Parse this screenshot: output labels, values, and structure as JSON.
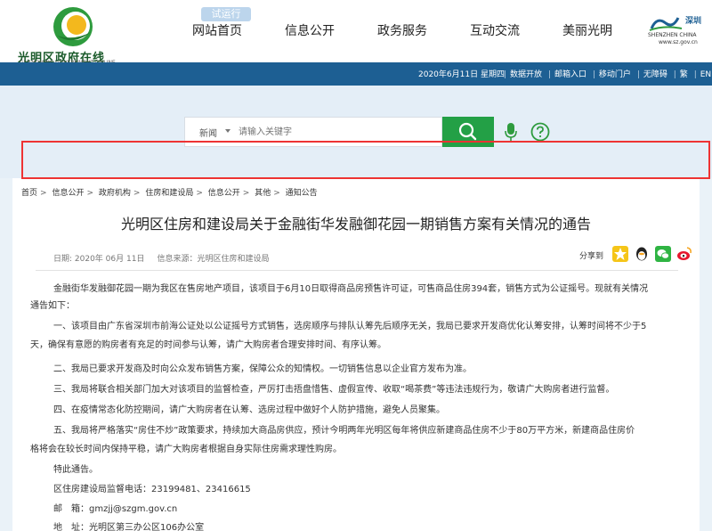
{
  "header": {
    "logo_text": "光明区政府在线",
    "logo_sub": "GUANGMING GOVERNMENT ONLINE",
    "trial_badge": "试运行",
    "nav": [
      "网站首页",
      "信息公开",
      "政务服务",
      "互动交流",
      "美丽光明"
    ],
    "sz_logo_text": "深圳",
    "sz_logo_sub": "SHENZHEN CHINA",
    "sz_logo_url": "www.sz.gov.cn"
  },
  "subbar": {
    "date": "2020年6月11日 星期四",
    "links": [
      "数据开放",
      "邮箱入口",
      "移动门户",
      "无障碍",
      "繁",
      "EN"
    ]
  },
  "search": {
    "category": "新闻",
    "placeholder": "请输入关键字"
  },
  "breadcrumb": [
    "首页",
    "信息公开",
    "政府机构",
    "住房和建设局",
    "信息公开",
    "其他",
    "通知公告"
  ],
  "article": {
    "title": "光明区住房和建设局关于金融街华发融御花园一期销售方案有关情况的通告",
    "date": "日期: 2020年 06月 11日",
    "source": "信息来源：光明区住房和建设局",
    "share_label": "分享到",
    "lines": [
      "金融街华发融御花园一期为我区在售房地产项目，该项目于6月10日取得商品房预售许可证，可售商品住房394套，销售方式为公证摇号。现就有关情况",
      "通告如下：",
      "一、该项目由广东省深圳市前海公证处以公证摇号方式销售，选房顺序与排队认筹先后顺序无关，我局已要求开发商优化认筹安排，认筹时间将不少于5",
      "天，确保有意愿的购房者有充足的时间参与认筹，请广大购房者合理安排时间、有序认筹。",
      "二、我局已要求开发商及时向公众发布销售方案，保障公众的知情权。一切销售信息以企业官方发布为准。",
      "三、我局将联合相关部门加大对该项目的监督检查，严厉打击捂盘惜售、虚假宣传、收取“喝茶费”等违法违规行为，敬请广大购房者进行监督。",
      "四、在疫情常态化防控期间，请广大购房者在认筹、选房过程中做好个人防护措施，避免人员聚集。",
      "五、我局将严格落实“房住不炒”政策要求，持续加大商品房供应，预计今明两年光明区每年将供应新建商品住房不少于80万平方米，新建商品住房价",
      "格将会在较长时间内保持平稳，请广大购房者根据自身实际住房需求理性购房。",
      "特此通告。",
      "区住房建设局监督电话：23199481、23416615",
      "邮　箱：gmzjj@szgm.gov.cn",
      "地　址：光明区第三办公区106办公室"
    ]
  },
  "colors": {
    "nav_blue": "#1d5f93",
    "search_green": "#23a046",
    "highlight_red": "#e33333"
  }
}
